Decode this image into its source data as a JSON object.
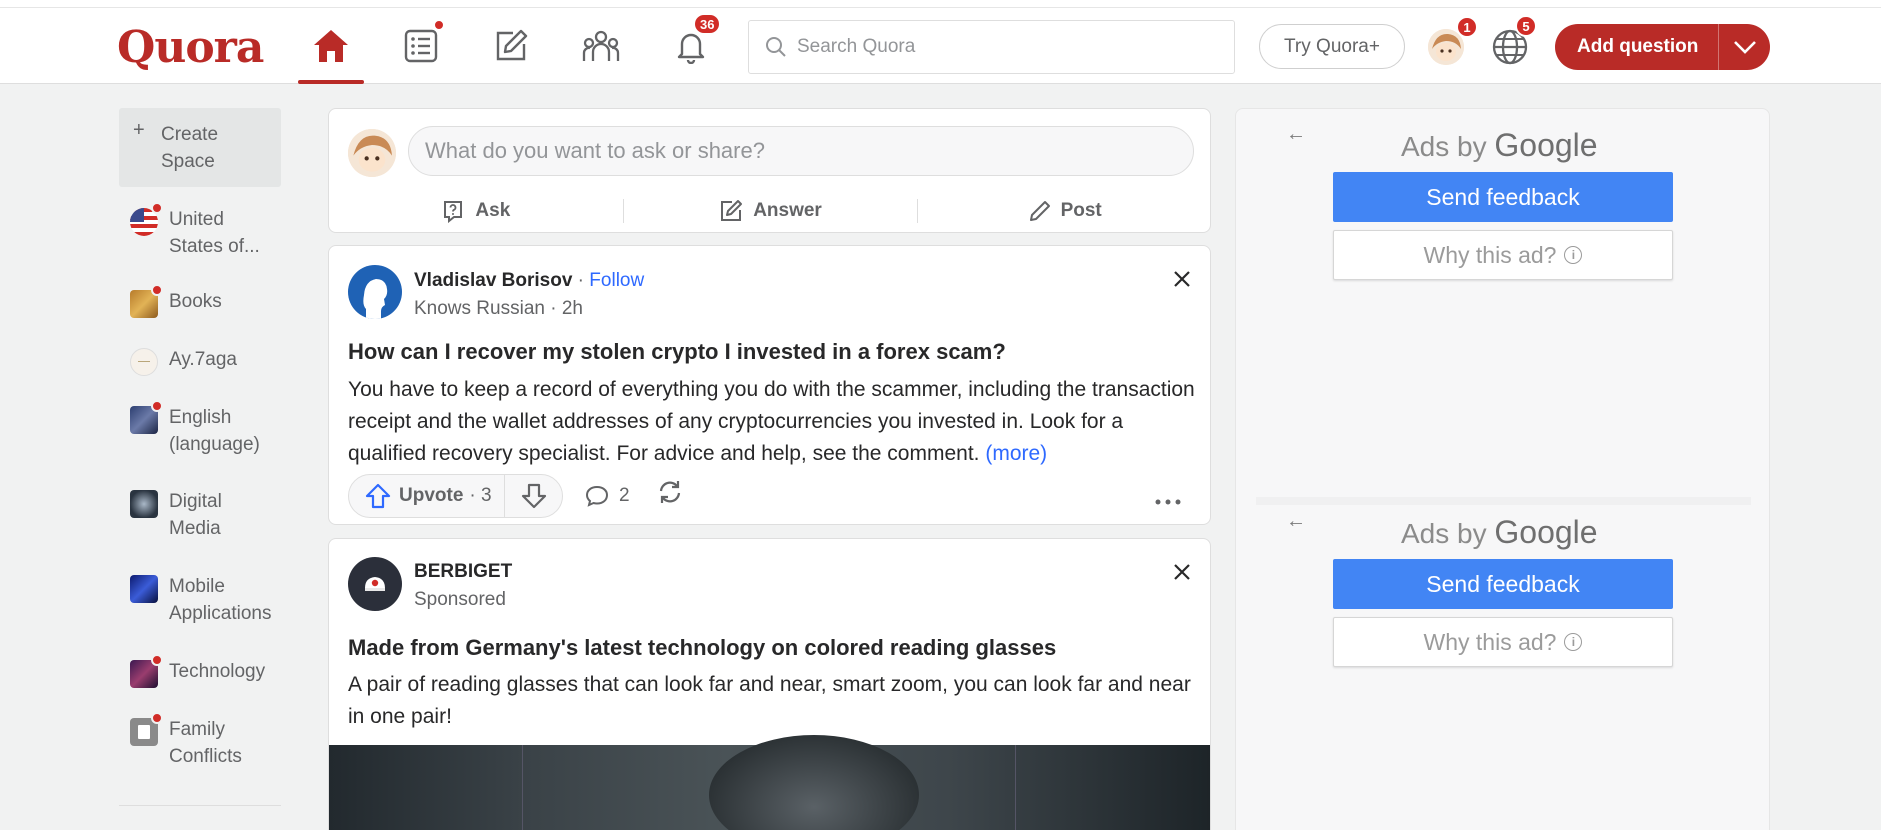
{
  "header": {
    "logo": "Quora",
    "notifications_count": "36",
    "search_placeholder": "Search Quora",
    "try_plus_label": "Try Quora+",
    "avatar_badge": "1",
    "language_badge": "5",
    "add_question_label": "Add question"
  },
  "sidebar": {
    "create_space": "Create Space",
    "items": [
      {
        "label": "United States of..."
      },
      {
        "label": "Books"
      },
      {
        "label": "Ay.7aga"
      },
      {
        "label": "English (language)"
      },
      {
        "label": "Digital Media"
      },
      {
        "label": "Mobile Applications"
      },
      {
        "label": "Technology"
      },
      {
        "label": "Family Conflicts"
      }
    ]
  },
  "ask_box": {
    "placeholder": "What do you want to ask or share?",
    "ask_label": "Ask",
    "answer_label": "Answer",
    "post_label": "Post"
  },
  "post": {
    "author": "Vladislav Borisov",
    "follow_label": "Follow",
    "meta": "Knows Russian · 2h",
    "title": "How can I recover my stolen crypto I invested in a forex scam?",
    "body": "You have to keep a record of everything you do with the scammer, including the transaction receipt and the wallet addresses of any cryptocurrencies you invested in. Look for a qualified recovery specialist. For advice and help, see the comment.",
    "more_label": "(more)",
    "upvote_label": "Upvote",
    "upvote_count": "· 3",
    "comment_count": "2"
  },
  "sponsored": {
    "brand": "BERBIGET",
    "meta": "Sponsored",
    "title": "Made from Germany's latest technology on colored reading glasses",
    "body": "A pair of reading glasses that can look far and near, smart zoom, you can look far and near in one pair!"
  },
  "ads": {
    "ads_by": "Ads by",
    "google": "Google",
    "send_feedback": "Send feedback",
    "why_this_ad": "Why this ad?"
  },
  "colors": {
    "brand": "#b92b27",
    "link": "#2e69ff",
    "google_blue": "#4285f4"
  }
}
